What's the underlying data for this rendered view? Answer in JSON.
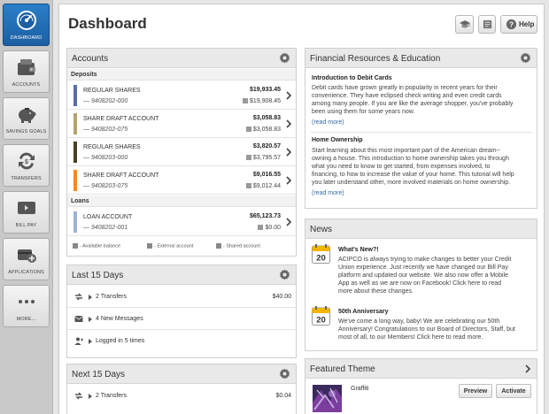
{
  "sidebar": {
    "items": [
      {
        "label": "DASHBOARD",
        "icon": "dashboard-icon",
        "active": true
      },
      {
        "label": "ACCOUNTS",
        "icon": "wallet-icon"
      },
      {
        "label": "SAVINGS GOALS",
        "icon": "piggy-bank-icon"
      },
      {
        "label": "TRANSFERS",
        "icon": "transfer-icon"
      },
      {
        "label": "BILL PAY",
        "icon": "bill-pay-icon"
      },
      {
        "label": "APPLICATIONS",
        "icon": "applications-icon"
      },
      {
        "label": "MORE...",
        "icon": "more-dots-icon"
      }
    ]
  },
  "header": {
    "title": "Dashboard",
    "help_label": "Help"
  },
  "accounts": {
    "title": "Accounts",
    "deposits_label": "Deposits",
    "loans_label": "Loans",
    "deposits": [
      {
        "name": "REGULAR SHARES",
        "number": "— 9408202-000",
        "balance": "$19,933.45",
        "available": "$19,908.45",
        "color": "#5b6ca8"
      },
      {
        "name": "SHARE DRAFT ACCOUNT",
        "number": "— 9408202-075",
        "balance": "$3,058.83",
        "available": "$3,058.83",
        "color": "#b5a46a"
      },
      {
        "name": "REGULAR SHARES",
        "number": "— 9408203-000",
        "balance": "$3,820.57",
        "available": "$3,795.57",
        "color": "#4a3f26"
      },
      {
        "name": "SHARE DRAFT ACCOUNT",
        "number": "— 9408203-075",
        "balance": "$9,016.55",
        "available": "$9,012.44",
        "color": "#ee8a2c"
      }
    ],
    "loans": [
      {
        "name": "LOAN ACCOUNT",
        "number": "— 9408202-001",
        "balance": "$65,123.73",
        "available": "$0.00",
        "color": "#9fb3d6"
      }
    ],
    "legend": {
      "available": "- Available balance",
      "external": "- External account",
      "shared": "- Shared account"
    }
  },
  "last15": {
    "title": "Last 15 Days",
    "rows": [
      {
        "text": "2 Transfers",
        "amount": "$40.00",
        "icon": "transfer-icon"
      },
      {
        "text": "4 New Messages",
        "amount": "",
        "icon": "envelope-icon"
      },
      {
        "text": "Logged in 5 times",
        "amount": "",
        "icon": "user-login-icon"
      }
    ]
  },
  "next15": {
    "title": "Next 15 Days",
    "rows": [
      {
        "text": "2 Transfers",
        "amount": "$0.04",
        "icon": "transfer-icon"
      }
    ]
  },
  "financial": {
    "title": "Financial Resources & Education",
    "articles": [
      {
        "title": "Introduction to Debit Cards",
        "lines": [
          "Debit cards have grown greatly in popularity in recent years for their",
          "convenience. They have eclipsed check writing and even credit cards",
          "among many people. If you are like the average shopper, you've probably",
          "been using them for some years now."
        ],
        "more": "(read more)"
      },
      {
        "title": "Home Ownership",
        "lines": [
          "Start learning about this most important part of the American dream--",
          "owning a house. This introduction to home ownership takes you through",
          "what you need to know to get started, from expenses involved, to",
          "financing, to how to increase the value of your home. This tutorial will help",
          "you later understand other, more involved materials on home ownership."
        ],
        "more": "(read more)"
      }
    ]
  },
  "news": {
    "title": "News",
    "items": [
      {
        "day": "20",
        "title": "What's New?!",
        "lines": [
          "ACIPCO is always trying to make changes to better your Credit",
          "Union experience. Just recently we have changed our Bill Pay",
          "platform and updated our website. We also now offer a Mobile",
          "App as well as we are now on Facebook! Click here to read",
          "more about these changes."
        ]
      },
      {
        "day": "20",
        "title": "50th Anniversary",
        "lines": [
          "We've come a long way, baby! We are celebrating our 50th",
          "Anniversary! Congratulations to our Board of Directors, Staff, but",
          "most of all, to our Members! Click here to read more."
        ]
      }
    ]
  },
  "theme": {
    "title": "Featured Theme",
    "name": "Graffiti",
    "preview_label": "Preview",
    "activate_label": "Activate"
  },
  "colors": {
    "accent": "#1c5fa3",
    "link": "#336aa8"
  }
}
